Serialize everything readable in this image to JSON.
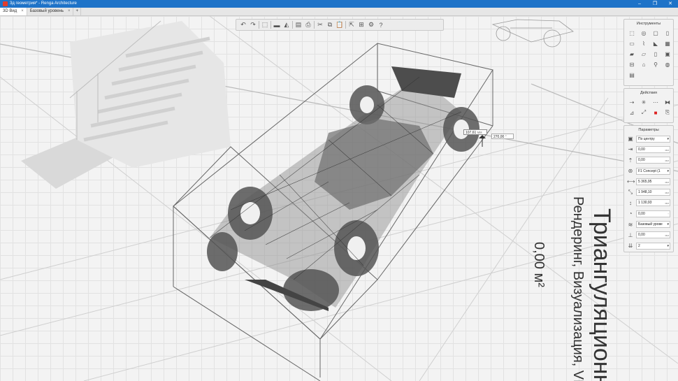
{
  "window": {
    "title": "3д геометрия* - Renga Architecture",
    "controls": [
      "–",
      "❐",
      "✕"
    ]
  },
  "tabs": [
    {
      "label": "3D Вид",
      "close": "×",
      "active": true
    },
    {
      "label": "Базовый уровень",
      "close": "×",
      "active": false
    }
  ],
  "add_tab": "+",
  "toolbar": {
    "icons": [
      "undo-icon",
      "redo-icon",
      "view-cube-icon",
      "section-box-icon",
      "layers-icon",
      "visibility-icon",
      "print-icon",
      "cut-icon",
      "copy-icon",
      "paste-icon",
      "export-icon",
      "properties-icon",
      "settings-icon",
      "help-icon"
    ],
    "glyphs": [
      "↶",
      "↷",
      "⬚",
      "▬",
      "◭",
      "▤",
      "⎙",
      "✂",
      "⧉",
      "📋",
      "⇱",
      "⊞",
      "⚙",
      "?"
    ]
  },
  "tools_panel": {
    "title": "Инструменты",
    "icons": [
      "select-arrow-icon",
      "model-text-icon",
      "wall-icon",
      "column-icon",
      "beam-icon",
      "railing-icon",
      "roof-icon",
      "stair-icon",
      "floor-icon",
      "opening-icon",
      "door-icon",
      "window-icon",
      "ramp-icon",
      "room-icon",
      "equipment-icon",
      "furniture-icon",
      "model-icon"
    ],
    "glyphs": [
      "⬚",
      "◎",
      "▢",
      "▯",
      "▭",
      "⌇",
      "◣",
      "▦",
      "▰",
      "▱",
      "▯",
      "▣",
      "⊟",
      "⌂",
      "⚲",
      "◍",
      "▤"
    ]
  },
  "actions_panel": {
    "title": "Действия",
    "icons": [
      "move-icon",
      "rotate-icon",
      "array-icon",
      "mirror-icon",
      "align-icon",
      "measure-icon",
      "delete-icon",
      "copy-properties-icon"
    ],
    "glyphs": [
      "⇢",
      "✳",
      "⋯",
      "⧓",
      "⊿",
      "⤢",
      "■",
      "⎘"
    ]
  },
  "params_panel": {
    "title": "Параметры",
    "rows": [
      {
        "icon": "placement-icon",
        "glyph": "▣",
        "value": "По центру",
        "unit": "▾",
        "dropdown": true
      },
      {
        "icon": "offset-x-icon",
        "glyph": "⇥",
        "value": "0,00",
        "unit": "мм",
        "dropdown": false
      },
      {
        "icon": "offset-y-icon",
        "glyph": "⇡",
        "value": "0,00",
        "unit": "мм",
        "dropdown": false
      },
      {
        "icon": "model-style-icon",
        "glyph": "⊛",
        "value": "F1 Concept (1",
        "unit": "▾",
        "dropdown": true
      },
      {
        "icon": "length-icon",
        "glyph": "⟷",
        "value": "5 365,95",
        "unit": "мм",
        "dropdown": false
      },
      {
        "icon": "width-icon",
        "glyph": "⤡",
        "value": "1 948,10",
        "unit": "мм",
        "dropdown": false
      },
      {
        "icon": "height-icon",
        "glyph": "↕",
        "value": "1 130,93",
        "unit": "мм",
        "dropdown": false
      },
      {
        "icon": "angle-icon",
        "glyph": "◔",
        "value": "0,00",
        "unit": "°",
        "dropdown": false
      },
      {
        "icon": "level-icon",
        "glyph": "≋",
        "value": "Базовый урове",
        "unit": "▾",
        "dropdown": true
      },
      {
        "icon": "elevation-icon",
        "glyph": "⊥",
        "value": "0,00",
        "unit": "мм",
        "dropdown": false
      },
      {
        "icon": "level-offset-icon",
        "glyph": "⇊",
        "value": "2",
        "unit": "▾",
        "dropdown": true
      }
    ]
  },
  "dimensions": {
    "a_value": "107,61",
    "a_unit": "мм",
    "b_value": "270,00",
    "b_unit": "°"
  },
  "model_text": {
    "line1": "Триангуляционн",
    "line2": "Рендеринг, Визуализация, VR",
    "line3": "0,00 м²"
  }
}
